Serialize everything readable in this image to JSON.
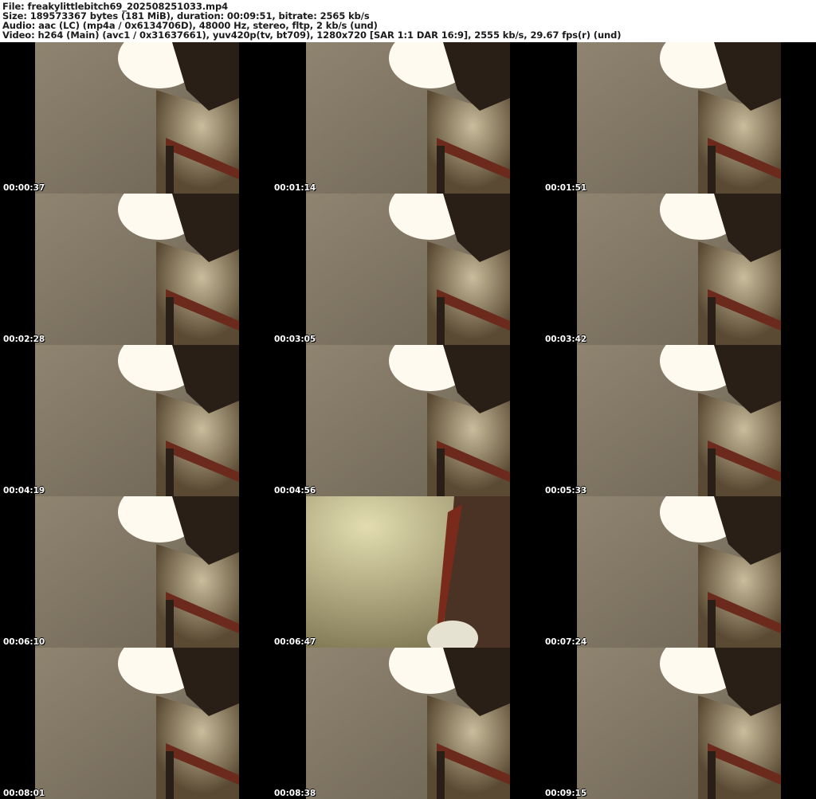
{
  "header": {
    "file_line": "File: freakylittlebitch69_202508251033.mp4",
    "size_line": "Size: 189573367 bytes (181 MiB), duration: 00:09:51, bitrate: 2565 kb/s",
    "audio_line": "Audio: aac (LC) (mp4a / 0x6134706D), 48000 Hz, stereo, fltp, 2 kb/s (und)",
    "video_line": "Video: h264 (Main) (avc1 / 0x31637661), yuv420p(tv, bt709), 1280x720 [SAR 1:1 DAR 16:9], 2555 kb/s, 29.67 fps(r) (und)"
  },
  "thumbnails": [
    {
      "timestamp": "00:00:37",
      "scene": "lamp"
    },
    {
      "timestamp": "00:01:14",
      "scene": "lamp"
    },
    {
      "timestamp": "00:01:51",
      "scene": "lamp"
    },
    {
      "timestamp": "00:02:28",
      "scene": "lamp"
    },
    {
      "timestamp": "00:03:05",
      "scene": "lamp"
    },
    {
      "timestamp": "00:03:42",
      "scene": "lamp"
    },
    {
      "timestamp": "00:04:19",
      "scene": "lamp"
    },
    {
      "timestamp": "00:04:56",
      "scene": "lamp"
    },
    {
      "timestamp": "00:05:33",
      "scene": "lamp"
    },
    {
      "timestamp": "00:06:10",
      "scene": "lamp"
    },
    {
      "timestamp": "00:06:47",
      "scene": "wall"
    },
    {
      "timestamp": "00:07:24",
      "scene": "lamp"
    },
    {
      "timestamp": "00:08:01",
      "scene": "lamp"
    },
    {
      "timestamp": "00:08:38",
      "scene": "lamp"
    },
    {
      "timestamp": "00:09:15",
      "scene": "lamp"
    }
  ],
  "colors": {
    "wall": "#8f8470",
    "wall_light": "#c9bd9c",
    "lamp": "#fffaf0",
    "dark": "#2a1f16",
    "trim": "#6b2a1c"
  }
}
